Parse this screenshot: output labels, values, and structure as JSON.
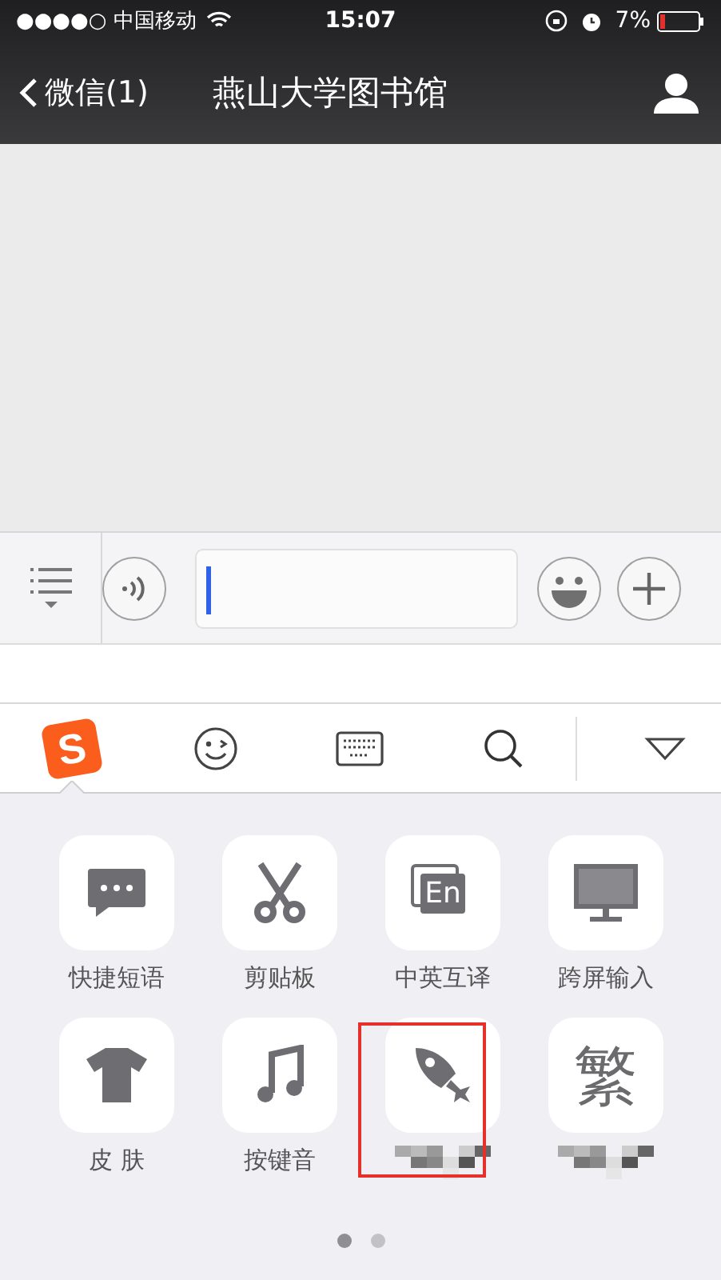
{
  "status_bar": {
    "carrier": "●●●●○ 中国移动",
    "time": "15:07",
    "battery": "7%"
  },
  "nav": {
    "back": "微信(1)",
    "title": "燕山大学图书馆"
  },
  "input_bar": {
    "focused": true
  },
  "toolbar": {
    "tabs": [
      {
        "kind": "logo",
        "text": "S",
        "selected": true
      },
      {
        "kind": "emoji",
        "selected": false
      },
      {
        "kind": "keyboard",
        "selected": false
      },
      {
        "kind": "search",
        "selected": false
      }
    ]
  },
  "tools": [
    {
      "kind": "chat",
      "label": "快捷短语",
      "highlighted": false
    },
    {
      "kind": "scissors",
      "label": "剪贴板",
      "highlighted": false
    },
    {
      "kind": "translate",
      "glyph": "En",
      "label": "中英互译",
      "highlighted": false
    },
    {
      "kind": "monitor",
      "label": "跨屏输入",
      "highlighted": false
    },
    {
      "kind": "shirt",
      "label": "皮 肤",
      "highlighted": false
    },
    {
      "kind": "music",
      "label": "按键音",
      "highlighted": false
    },
    {
      "kind": "rocket",
      "highlighted": true
    },
    {
      "kind": "glyph",
      "glyph": "繁",
      "highlighted": false
    }
  ],
  "pages": [
    {
      "selected": true
    },
    {
      "selected": false
    }
  ]
}
